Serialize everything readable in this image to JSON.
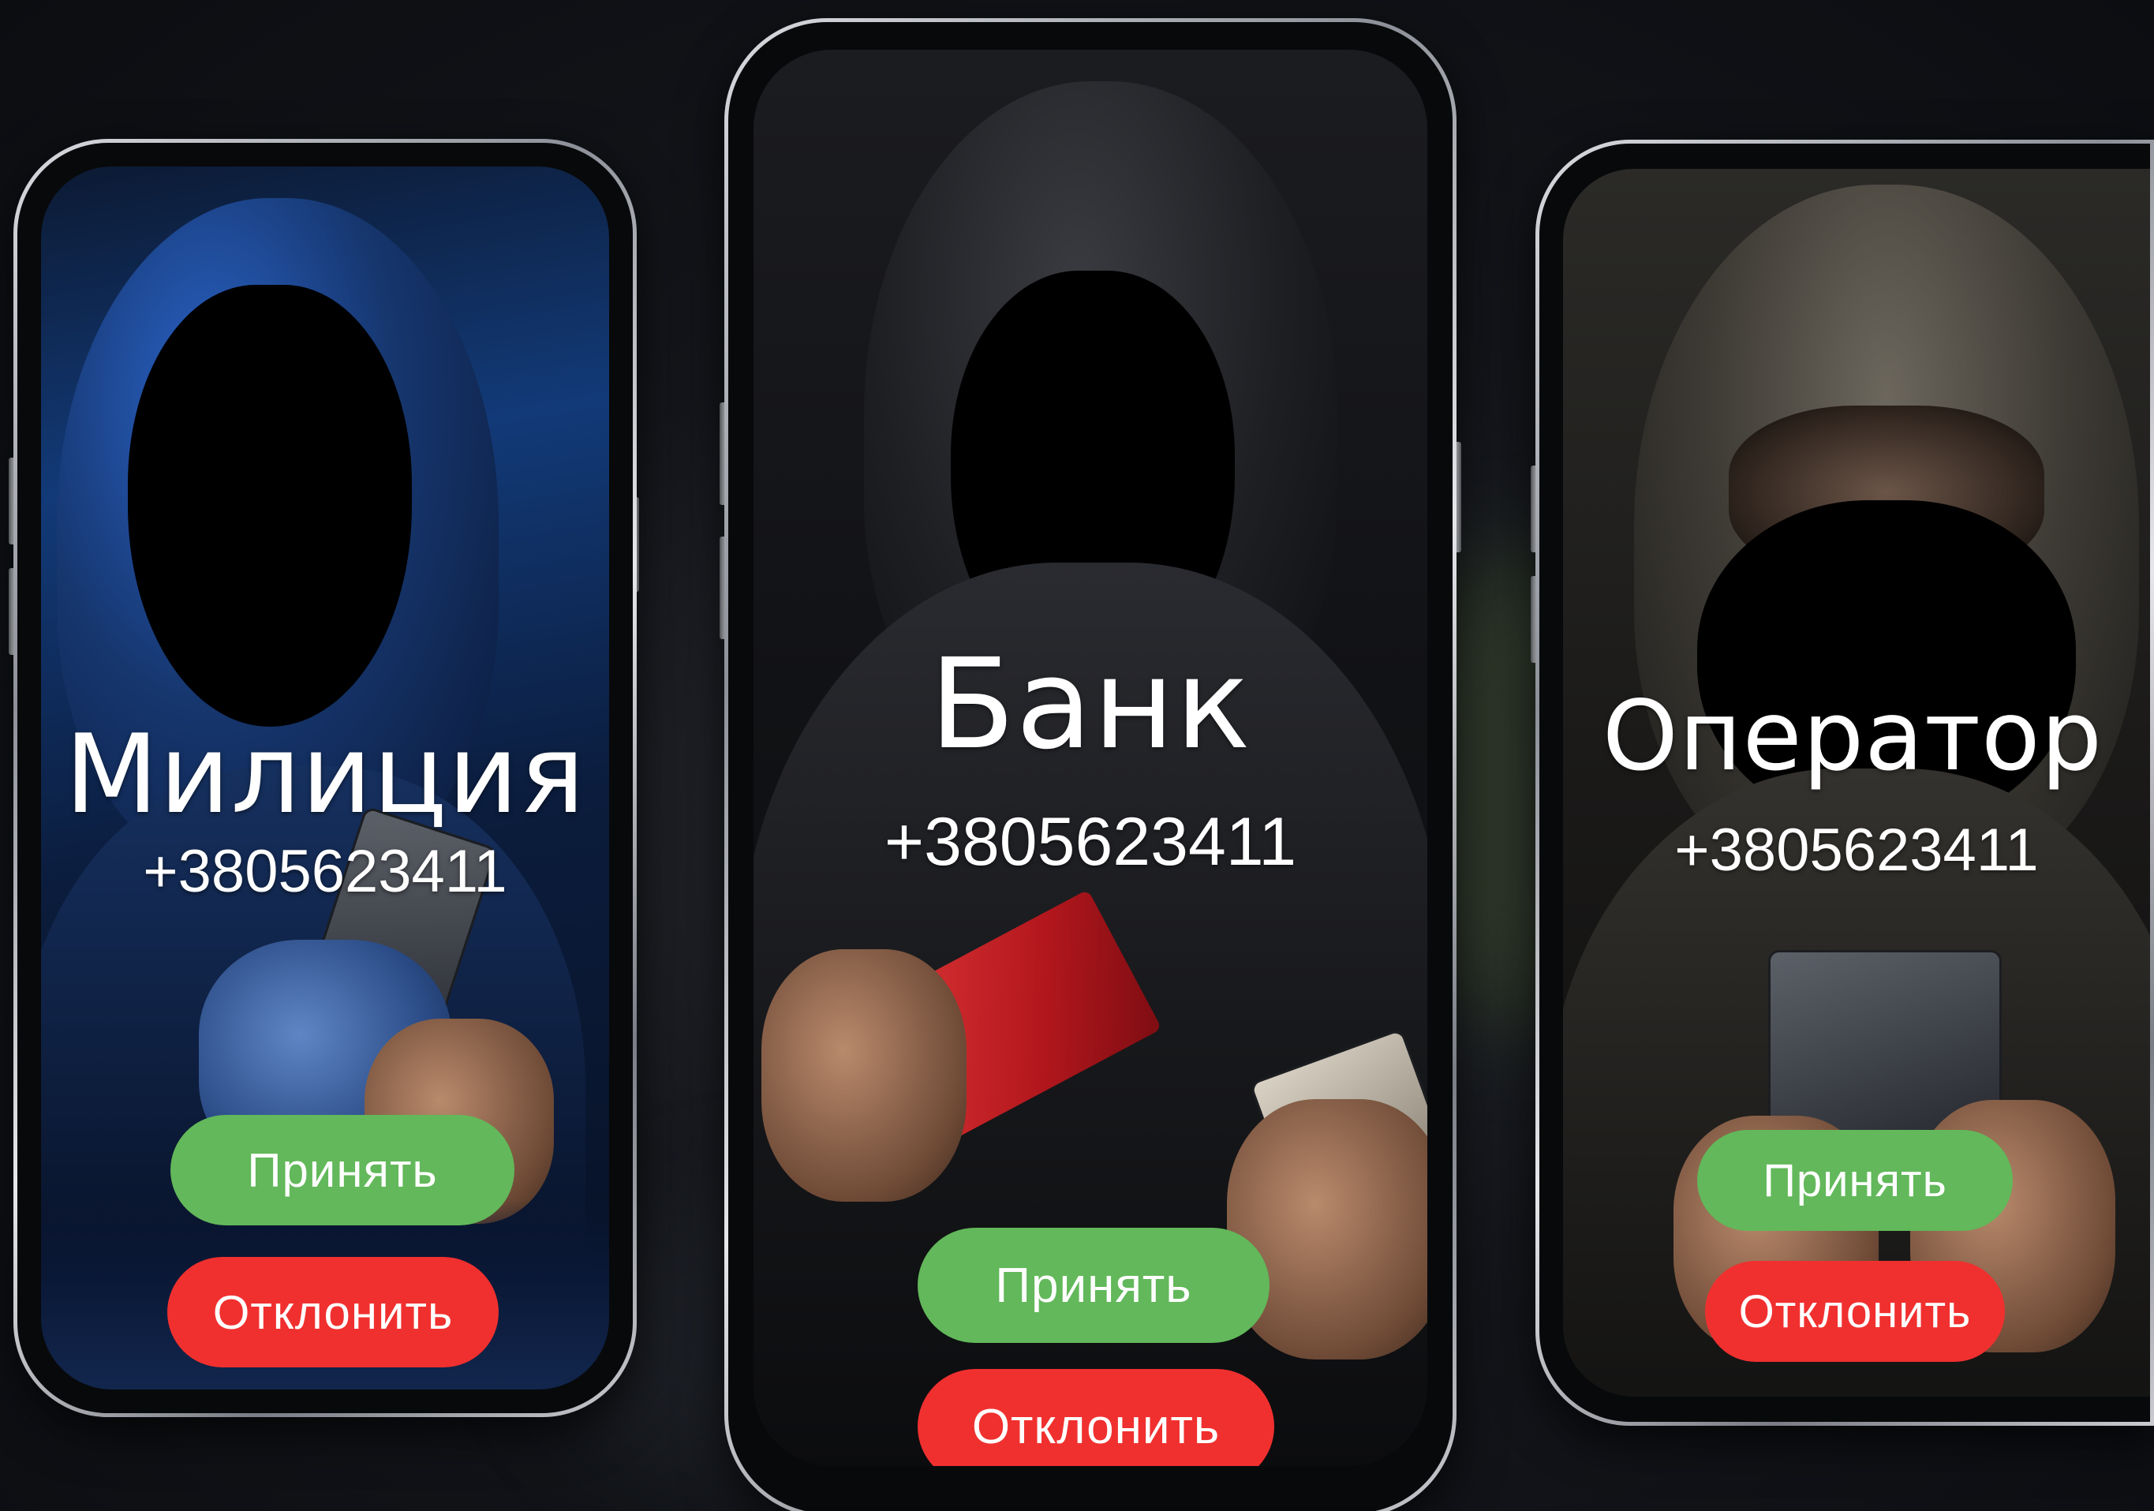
{
  "colors": {
    "accept": "#62b85a",
    "decline": "#f0302f",
    "background": "#0d0f14",
    "text": "#ffffff"
  },
  "phones": [
    {
      "caller_name": "Милиция",
      "caller_number": "+3805623411",
      "accept_label": "Принять",
      "decline_label": "Отклонить"
    },
    {
      "caller_name": "Банк",
      "caller_number": "+3805623411",
      "accept_label": "Принять",
      "decline_label": "Отклонить"
    },
    {
      "caller_name": "Оператор",
      "caller_number": "+3805623411",
      "accept_label": "Принять",
      "decline_label": "Отклонить"
    }
  ]
}
